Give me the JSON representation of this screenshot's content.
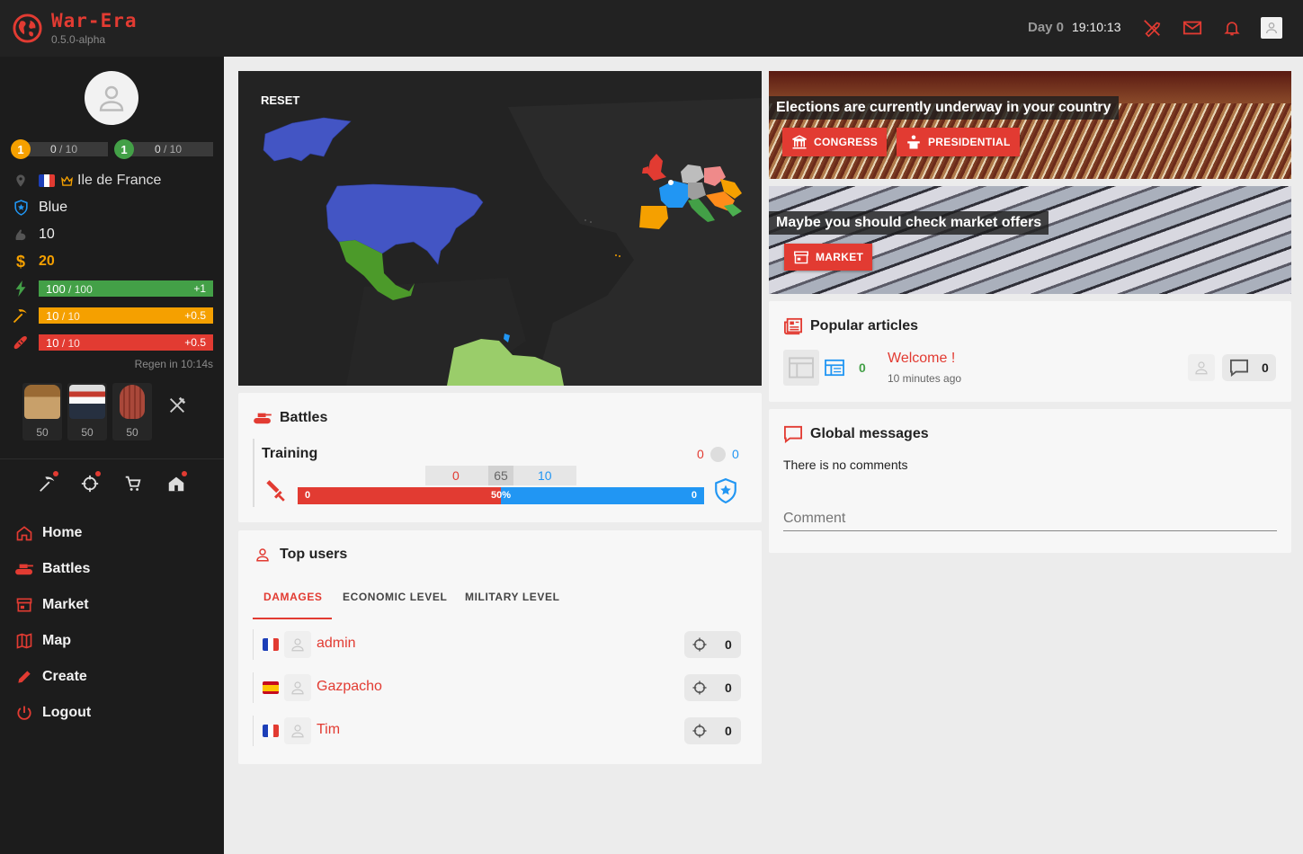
{
  "app": {
    "name": "War-Era",
    "version": "0.5.0-alpha"
  },
  "topbar": {
    "day_label": "Day 0",
    "time": "19:10:13"
  },
  "levels": [
    {
      "level": "1",
      "current": "0",
      "max": "/ 10",
      "color": "#f5a000"
    },
    {
      "level": "1",
      "current": "0",
      "max": "/ 10",
      "color": "#43a047"
    }
  ],
  "profile": {
    "region": "Ile de France",
    "party": "Blue",
    "strength": "10",
    "money": "20"
  },
  "energy": [
    {
      "name": "health",
      "current": "100",
      "max": "/ 100",
      "regen": "+1",
      "color": "#43a047",
      "fill": 1.0
    },
    {
      "name": "work",
      "current": "10",
      "max": "/ 10",
      "regen": "+0.5",
      "color": "#f5a000",
      "fill": 1.0
    },
    {
      "name": "hunger",
      "current": "10",
      "max": "/ 10",
      "regen": "+0.5",
      "color": "#e23b32",
      "fill": 1.0
    }
  ],
  "regen_text": "Regen in 10:14s",
  "food": [
    {
      "name": "bread",
      "count": "50"
    },
    {
      "name": "sushi",
      "count": "50"
    },
    {
      "name": "steak",
      "count": "50"
    }
  ],
  "nav": [
    {
      "label": "Home",
      "icon": "home-icon"
    },
    {
      "label": "Battles",
      "icon": "tank-icon"
    },
    {
      "label": "Market",
      "icon": "store-icon"
    },
    {
      "label": "Map",
      "icon": "map-icon"
    },
    {
      "label": "Create",
      "icon": "pencil-icon"
    },
    {
      "label": "Logout",
      "icon": "power-icon"
    }
  ],
  "map": {
    "reset_label": "RESET"
  },
  "banners": {
    "elections": {
      "title": "Elections are currently underway in your country",
      "congress": "CONGRESS",
      "presidential": "PRESIDENTIAL"
    },
    "market": {
      "title": "Maybe you should check market offers",
      "button": "MARKET"
    }
  },
  "battles": {
    "title": "Battles",
    "battle": {
      "name": "Training",
      "score_attacker": "0",
      "score_defender": "0",
      "stat_attacker": "0",
      "stat_middle": "65",
      "stat_defender": "10",
      "bar_left": "0",
      "bar_percent": "50%",
      "bar_right": "0",
      "attacker_share": 0.5
    }
  },
  "top_users": {
    "title": "Top users",
    "tabs": [
      "DAMAGES",
      "ECONOMIC LEVEL",
      "MILITARY LEVEL"
    ],
    "users": [
      {
        "name": "admin",
        "country": "France",
        "damage": "0"
      },
      {
        "name": "Gazpacho",
        "country": "Spain",
        "damage": "0"
      },
      {
        "name": "Tim",
        "country": "France",
        "damage": "0"
      }
    ]
  },
  "articles": {
    "title": "Popular articles",
    "items": [
      {
        "votes": "0",
        "title": "Welcome !",
        "time": "10 minutes ago",
        "comments": "0"
      }
    ]
  },
  "messages": {
    "title": "Global messages",
    "empty_text": "There is no comments",
    "comment_placeholder": "Comment"
  },
  "colors": {
    "accent": "#e23b32",
    "blue": "#2196f3",
    "green": "#43a047",
    "orange": "#f5a000"
  }
}
